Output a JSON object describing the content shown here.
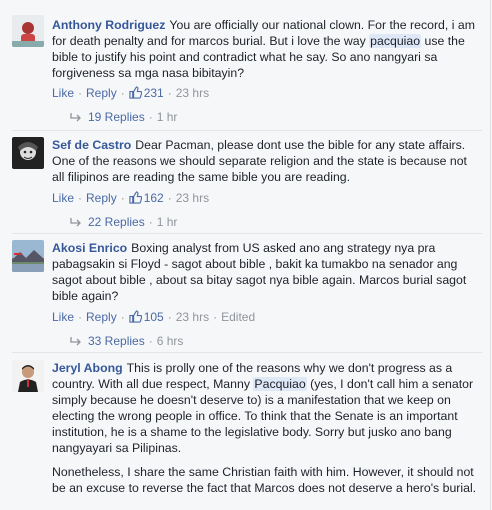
{
  "comments": [
    {
      "author": "Anthony Rodriguez",
      "text_a": "You are officially our national clown. For the record, i am for death penalty and for marcos burial. But i love the way ",
      "highlight": "pacquiao",
      "text_b": " use the bible to justify his point and contradict what he say. So ano nangyari sa forgiveness sa mga nasa bibitayin?",
      "like": "Like",
      "reply": "Reply",
      "likes": "231",
      "time": "23 hrs",
      "replies": "19 Replies",
      "replies_time": "1 hr"
    },
    {
      "author": "Sef de Castro",
      "text": "Dear Pacman, please dont use the bible for any state affairs. One of the reasons we should separate religion and the state is because not all filipinos are reading the same bible you are reading.",
      "like": "Like",
      "reply": "Reply",
      "likes": "162",
      "time": "23 hrs",
      "replies": "22 Replies",
      "replies_time": "1 hr"
    },
    {
      "author": "Akosi Enrico",
      "text": "Boxing analyst from US asked ano ang strategy nya pra pabagsakin si Floyd - sagot about bible , bakit ka tumakbo na senador ang sagot about bible , about sa bitay sagot nya bible again. Marcos burial sagot bible again?",
      "like": "Like",
      "reply": "Reply",
      "likes": "105",
      "time": "23 hrs",
      "edited": "Edited",
      "replies": "33 Replies",
      "replies_time": "6 hrs"
    },
    {
      "author": "Jeryl Abong",
      "text_a": "This is prolly one of the reasons why we don't progress as a country. With all due respect, Manny ",
      "highlight": "Pacquiao",
      "text_b": " (yes, I don't call him a senator simply because he doesn't deserve to) is a manifestation that we keep on electing the wrong people in office. To think that the Senate is an important institution, he is a shame to the legislative body. Sorry but jusko ano bang nangyayari sa Pilipinas.",
      "text2": "Nonetheless, I share the same Christian faith with him. However, it should not be an excuse to reverse the fact that Marcos does not deserve a hero's burial."
    }
  ],
  "colors": {
    "author": "#365899",
    "meta": "#90949c",
    "highlight_bg": "#dfe8f7",
    "background": "#f6f7f9"
  }
}
